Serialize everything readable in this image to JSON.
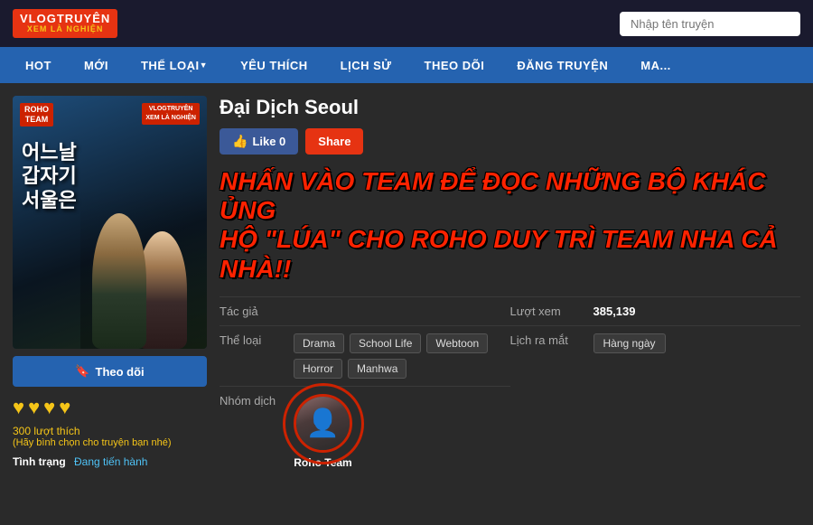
{
  "site": {
    "logo_top": "VLOGTRUYÊN",
    "logo_bottom": "XEM LÀ NGHIỆN",
    "search_placeholder": "Nhập tên truyện"
  },
  "nav": {
    "items": [
      {
        "label": "HOT"
      },
      {
        "label": "MỚI"
      },
      {
        "label": "THỂ LOẠI",
        "arrow": true
      },
      {
        "label": "YÊU THÍCH"
      },
      {
        "label": "LỊCH SỬ"
      },
      {
        "label": "THEO DÕI"
      },
      {
        "label": "ĐĂNG TRUYỆN"
      },
      {
        "label": "MA..."
      }
    ]
  },
  "manga": {
    "title": "Đại Dịch Seoul",
    "like_label": "Like 0",
    "share_label": "Share",
    "promo_line1": "NHẤN VÀO TEAM ĐỂ ĐỌC NHỮNG BỘ KHÁC ỦNG",
    "promo_line2": "HỘ \"LÚA\" CHO ROHO DUY TRÌ TEAM NHA CẢ NHÀ!!",
    "author_label": "Tác giả",
    "author_value": "",
    "genre_label": "Thể loại",
    "genres": [
      "Drama",
      "School Life",
      "Webtoon",
      "Horror",
      "Manhwa"
    ],
    "group_label": "Nhóm dịch",
    "group_name": "Roho Team",
    "views_label": "Lượt xem",
    "views_value": "385,139",
    "release_label": "Lịch ra mắt",
    "release_value": "Hàng ngày",
    "follow_label": "Theo dõi",
    "stars": [
      "♥",
      "♥",
      "♥",
      "♥"
    ],
    "likes_count": "300 lượt thích",
    "likes_note": "(Hãy bình chọn cho truyện bạn nhé)",
    "status_label": "Tình trạng",
    "status_value": "Đang tiến hành"
  }
}
